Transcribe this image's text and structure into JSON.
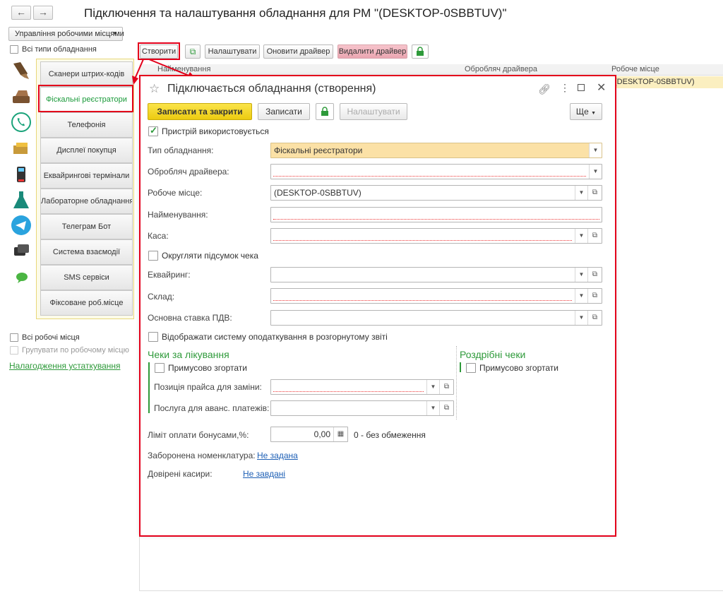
{
  "nav": {
    "back": "←",
    "forward": "→"
  },
  "page_title": "Підключення та налаштування обладнання для РМ \"(DESKTOP-0SBBTUV)\"",
  "workplace_menu": "Управління робочими місцями",
  "all_types_label": "Всі типи обладнання",
  "toolbar": {
    "create": "Створити",
    "configure": "Налаштувати",
    "update_driver": "Оновити драйвер",
    "delete_driver": "Видалити драйвер"
  },
  "tabs": [
    "Сканери штрих-кодів",
    "Фіскальні реєстратори",
    "Телефонія",
    "Дисплеї покупця",
    "Еквайрингові термінали",
    "Лабораторне обладнання",
    "Телеграм Бот",
    "Система взаємодії",
    "SMS сервіси",
    "Фіксоване роб.місце"
  ],
  "table": {
    "columns": [
      "Найменування",
      "Обробляч драйвера",
      "Робоче місце"
    ],
    "row_value": "(DESKTOP-0SBBTUV)"
  },
  "left_bottom": {
    "all_workplaces": "Всі робочі місця",
    "group_by_workplace": "Групувати по робочому місцю",
    "setup_link": "Налагодження устаткування"
  },
  "dialog": {
    "title": "Підключається обладнання (створення)",
    "write_close": "Записати та закрити",
    "write": "Записати",
    "configure": "Налаштувати",
    "more": "Ще",
    "device_used": "Пристрій використовується",
    "fields": {
      "type_label": "Тип обладнання:",
      "type_value": "Фіскальні реєстратори",
      "driver_label": "Обробляч драйвера:",
      "workplace_label": "Робоче місце:",
      "workplace_value": "(DESKTOP-0SBBTUV)",
      "name_label": "Найменування:",
      "cash_label": "Каса:",
      "round_label": "Округляти підсумок чека",
      "acquiring_label": "Еквайринг:",
      "warehouse_label": "Склад:",
      "vat_label": "Основна ставка ПДВ:",
      "tax_system_label": "Відображати систему оподаткування в розгорнутому звіті"
    },
    "treatment": {
      "header": "Чеки за лікування",
      "force_collapse": "Примусово згортати",
      "price_item_label": "Позиція прайса для заміни:",
      "advance_label": "Послуга для аванс. платежів:"
    },
    "retail": {
      "header": "Роздрібні чеки",
      "force_collapse": "Примусово згортати"
    },
    "bonus_label": "Ліміт оплати бонусами,%:",
    "bonus_value": "0,00",
    "bonus_note": "0 - без обмеження",
    "forbidden_label": "Заборонена номенклатура:",
    "forbidden_link": "Не задана",
    "trusted_label": "Довірені касири:",
    "trusted_link": "Не завдані"
  },
  "colors": {
    "accent_green": "#2e9a3a",
    "highlight_red": "#e3001b",
    "primary_yellow": "#f5d422",
    "link_blue": "#1d5fb5"
  }
}
